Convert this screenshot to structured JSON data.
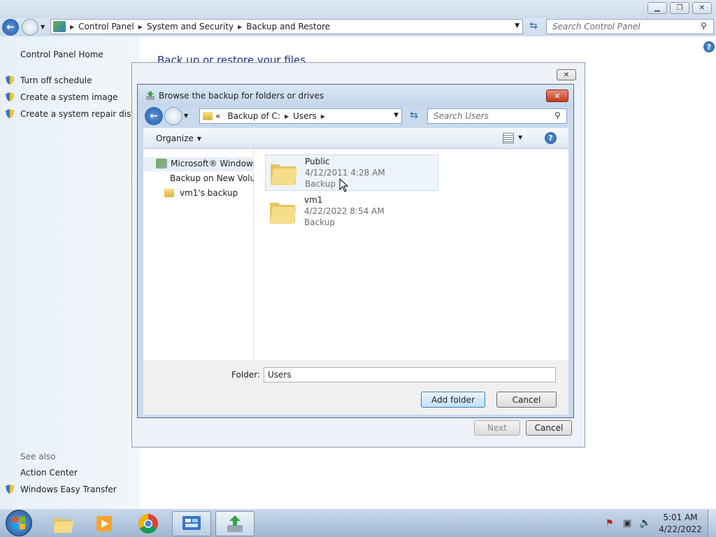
{
  "main": {
    "breadcrumb": [
      "Control Panel",
      "System and Security",
      "Backup and Restore"
    ],
    "search_placeholder": "Search Control Panel",
    "heading": "Back up or restore your files",
    "sidebar": {
      "home": "Control Panel Home",
      "items": [
        "Turn off schedule",
        "Create a system image",
        "Create a system repair disc"
      ],
      "see_also": "See also",
      "see_also_items": [
        "Action Center",
        "Windows Easy Transfer"
      ]
    }
  },
  "outer_dialog": {
    "next_label": "Next",
    "cancel_label": "Cancel"
  },
  "dialog": {
    "title": "Browse the backup for folders or drives",
    "address": {
      "prefix": "«",
      "crumbs": [
        "Backup of C:",
        "Users"
      ]
    },
    "search_placeholder": "Search Users",
    "organize_label": "Organize",
    "tree": [
      "Microsoft® Windows",
      "Backup on New Volu",
      "vm1's backup"
    ],
    "files": [
      {
        "name": "Public",
        "date": "4/12/2011 4:28 AM",
        "type": "Backup"
      },
      {
        "name": "vm1",
        "date": "4/22/2022 8:54 AM",
        "type": "Backup"
      }
    ],
    "folder_label": "Folder:",
    "folder_value": "Users",
    "add_folder_label": "Add folder",
    "cancel_label": "Cancel"
  },
  "taskbar": {
    "time": "5:01 AM",
    "date": "4/22/2022"
  },
  "colors": {
    "accent": "#3c74c2",
    "selection": "#e5f0fb"
  }
}
